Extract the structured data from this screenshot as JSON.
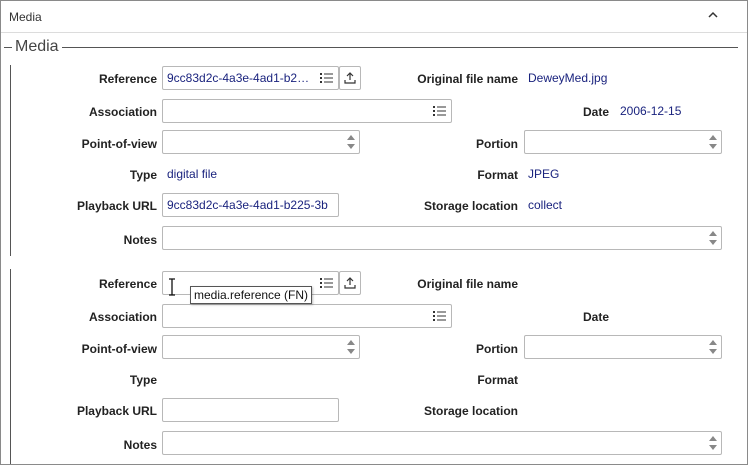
{
  "panel": {
    "header_title": "Media",
    "legend": "Media"
  },
  "labels": {
    "reference": "Reference",
    "original_file_name": "Original file name",
    "association": "Association",
    "date": "Date",
    "point_of_view": "Point-of-view",
    "portion": "Portion",
    "type": "Type",
    "format": "Format",
    "playback_url": "Playback URL",
    "storage_location": "Storage location",
    "notes": "Notes"
  },
  "media1": {
    "reference": "9cc83d2c-4a3e-4ad1-b2…",
    "original_file_name": "DeweyMed.jpg",
    "association": "",
    "date": "2006-12-15",
    "point_of_view": "",
    "portion": "",
    "type": "digital file",
    "format": "JPEG",
    "playback_url": "9cc83d2c-4a3e-4ad1-b225-3b",
    "storage_location": "collect",
    "notes": ""
  },
  "media2": {
    "reference": "",
    "original_file_name": "",
    "association": "",
    "date": "",
    "point_of_view": "",
    "portion": "",
    "type": "",
    "format": "",
    "playback_url": "",
    "storage_location": "",
    "notes": ""
  },
  "tooltip": "media.reference (FN)",
  "icons": {
    "list": "list-icon",
    "upload": "upload-icon",
    "spinner": "spinner-icon",
    "collapse": "chevron-up-icon",
    "cursor": "text-cursor-icon"
  },
  "colors": {
    "value_text": "#1a237e",
    "border": "#b8b8b8"
  }
}
